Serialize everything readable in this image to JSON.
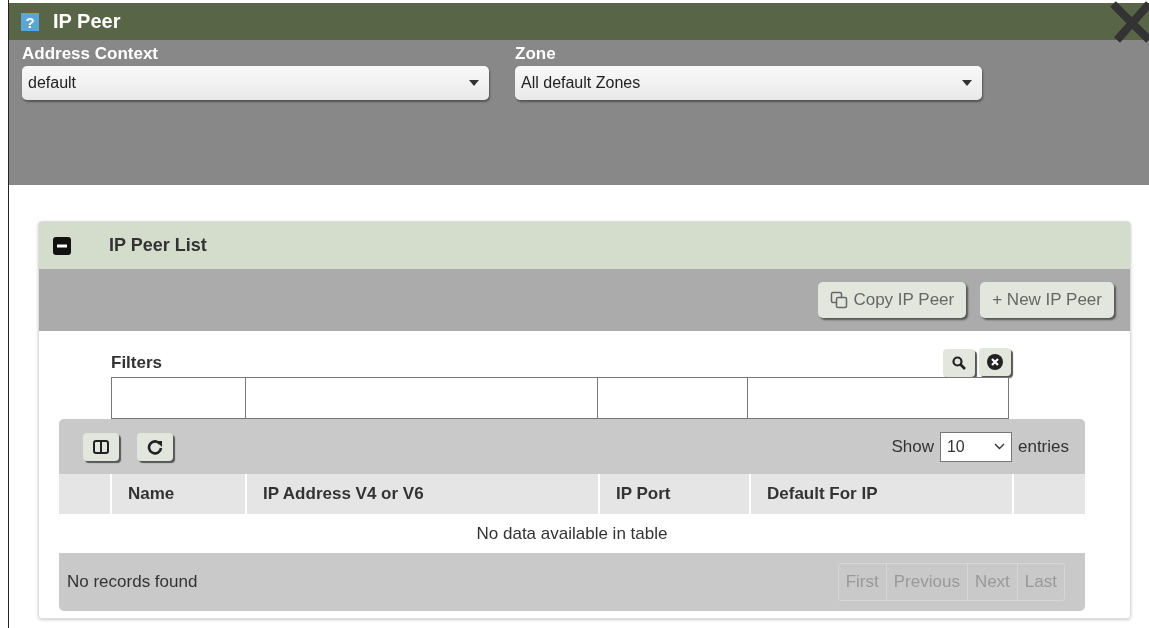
{
  "window": {
    "title": "IP Peer",
    "help_glyph": "?"
  },
  "fields": [
    {
      "label": "Address Context",
      "value": "default"
    },
    {
      "label": "Zone",
      "value": "All default Zones"
    }
  ],
  "panel": {
    "title": "IP Peer List",
    "expanded": true,
    "actions": [
      {
        "kind": "copy",
        "label": "Copy IP Peer"
      },
      {
        "kind": "new",
        "label": "+ New IP Peer"
      }
    ],
    "filters_label": "Filters",
    "show_label": "Show",
    "page_size": "10",
    "entries_label": "entries",
    "table": {
      "columns": [
        "Name",
        "IP Address V4 or V6",
        "IP Port",
        "Default For IP"
      ],
      "empty_message": "No data available in table"
    },
    "status": "No records found",
    "pager": [
      {
        "label": "First",
        "disabled": true
      },
      {
        "label": "Previous",
        "disabled": true
      },
      {
        "label": "Next",
        "disabled": true
      },
      {
        "label": "Last",
        "disabled": true
      }
    ]
  }
}
